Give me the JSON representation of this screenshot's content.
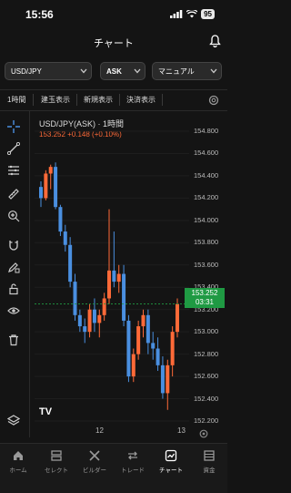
{
  "status_bar": {
    "time": "15:56",
    "battery": "95"
  },
  "header": {
    "title": "チャート"
  },
  "selectors": {
    "pair": "USD/JPY",
    "side": "ASK",
    "mode": "マニュアル"
  },
  "tabs": [
    "1時間",
    "建玉表示",
    "新規表示",
    "決済表示"
  ],
  "chart_header": {
    "title": "USD/JPY(ASK) · 1時間",
    "change": "153.252 +0.148 (+0.10%)"
  },
  "price_tag": {
    "price": "153.252",
    "countdown": "03:31"
  },
  "logo": "TV",
  "colors": {
    "up": "#ff6a38",
    "down": "#4a8fe0",
    "tag": "#1f9a43"
  },
  "chart_data": {
    "type": "candlestick",
    "y_ticks": [
      "154.800",
      "154.600",
      "154.400",
      "154.200",
      "154.000",
      "153.800",
      "153.600",
      "153.400",
      "153.200",
      "153.000",
      "152.800",
      "152.600",
      "152.400",
      "152.200"
    ],
    "x_ticks": [
      "12",
      "13"
    ],
    "ylim": [
      152.1,
      154.9
    ],
    "candles": [
      {
        "o": 154.3,
        "h": 154.35,
        "l": 154.12,
        "c": 154.2
      },
      {
        "o": 154.2,
        "h": 154.45,
        "l": 154.18,
        "c": 154.42
      },
      {
        "o": 154.42,
        "h": 154.5,
        "l": 154.28,
        "c": 154.48
      },
      {
        "o": 154.48,
        "h": 154.52,
        "l": 154.1,
        "c": 154.12
      },
      {
        "o": 154.12,
        "h": 154.14,
        "l": 153.86,
        "c": 153.9
      },
      {
        "o": 153.9,
        "h": 153.96,
        "l": 153.72,
        "c": 153.78
      },
      {
        "o": 153.78,
        "h": 153.85,
        "l": 153.4,
        "c": 153.45
      },
      {
        "o": 153.45,
        "h": 153.52,
        "l": 153.1,
        "c": 153.15
      },
      {
        "o": 153.15,
        "h": 153.2,
        "l": 153.0,
        "c": 153.05
      },
      {
        "o": 153.05,
        "h": 153.12,
        "l": 152.9,
        "c": 153.0
      },
      {
        "o": 153.0,
        "h": 153.25,
        "l": 152.95,
        "c": 153.2
      },
      {
        "o": 153.2,
        "h": 153.3,
        "l": 153.0,
        "c": 153.08
      },
      {
        "o": 153.08,
        "h": 153.2,
        "l": 152.95,
        "c": 153.15
      },
      {
        "o": 153.15,
        "h": 153.35,
        "l": 153.1,
        "c": 153.3
      },
      {
        "o": 153.3,
        "h": 154.1,
        "l": 153.25,
        "c": 153.55
      },
      {
        "o": 153.55,
        "h": 153.9,
        "l": 153.4,
        "c": 153.45
      },
      {
        "o": 153.45,
        "h": 153.6,
        "l": 153.35,
        "c": 153.52
      },
      {
        "o": 153.52,
        "h": 153.6,
        "l": 153.05,
        "c": 153.1
      },
      {
        "o": 153.1,
        "h": 153.15,
        "l": 152.55,
        "c": 152.6
      },
      {
        "o": 152.6,
        "h": 152.85,
        "l": 152.55,
        "c": 152.8
      },
      {
        "o": 152.8,
        "h": 153.1,
        "l": 152.75,
        "c": 153.05
      },
      {
        "o": 153.05,
        "h": 153.2,
        "l": 152.95,
        "c": 153.15
      },
      {
        "o": 153.15,
        "h": 153.2,
        "l": 152.8,
        "c": 152.9
      },
      {
        "o": 152.9,
        "h": 153.0,
        "l": 152.75,
        "c": 152.85
      },
      {
        "o": 152.85,
        "h": 152.95,
        "l": 152.65,
        "c": 152.7
      },
      {
        "o": 152.7,
        "h": 152.78,
        "l": 152.4,
        "c": 152.45
      },
      {
        "o": 152.45,
        "h": 152.75,
        "l": 152.3,
        "c": 152.7
      },
      {
        "o": 152.7,
        "h": 153.05,
        "l": 152.6,
        "c": 153.0
      },
      {
        "o": 153.0,
        "h": 153.3,
        "l": 152.95,
        "c": 153.25
      }
    ]
  },
  "bottom_nav": [
    {
      "label": "ホーム",
      "icon": "home-icon"
    },
    {
      "label": "セレクト",
      "icon": "select-icon"
    },
    {
      "label": "ビルダー",
      "icon": "builder-icon"
    },
    {
      "label": "トレード",
      "icon": "trade-icon"
    },
    {
      "label": "チャート",
      "icon": "chart-icon"
    },
    {
      "label": "資金",
      "icon": "funds-icon"
    }
  ]
}
